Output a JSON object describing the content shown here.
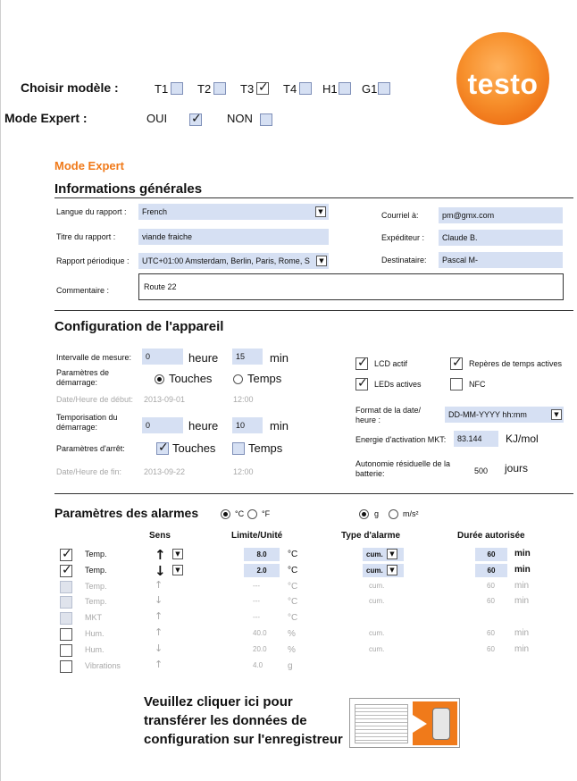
{
  "header": {
    "model_label": "Choisir modèle :",
    "models": [
      {
        "name": "T1",
        "checked": false
      },
      {
        "name": "T2",
        "checked": false
      },
      {
        "name": "T3",
        "checked": true
      },
      {
        "name": "T4",
        "checked": false
      },
      {
        "name": "H1",
        "checked": false
      },
      {
        "name": "G1",
        "checked": false
      }
    ],
    "expert_label": "Mode Expert :",
    "oui": "OUI",
    "non": "NON",
    "oui_checked": true,
    "non_checked": false,
    "logo": "testo",
    "brand_color": "#f07a1a"
  },
  "section_title": "Mode Expert",
  "general": {
    "title": "Informations générales",
    "langue_label": "Langue du rapport :",
    "langue_value": "French",
    "titre_label": "Titre du rapport :",
    "titre_value": "viande fraiche",
    "periodique_label": "Rapport périodique :",
    "periodique_value": "UTC+01:00  Amsterdam, Berlin, Paris, Rome, S",
    "courriel_label": "Courriel à:",
    "courriel_value": "pm@gmx.com",
    "expediteur_label": "Expéditeur :",
    "expediteur_value": "Claude B.",
    "destinataire_label": "Destinataire:",
    "destinataire_value": "Pascal M-",
    "commentaire_label": "Commentaire :",
    "commentaire_value": "Route 22"
  },
  "device": {
    "title": "Configuration de l'appareil",
    "intervalle_label": "Intervalle de mesure:",
    "intervalle_h": "0",
    "intervalle_m": "15",
    "heure": "heure",
    "min": "min",
    "demarrage_label": "Paramètres de démarrage:",
    "touches": "Touches",
    "temps": "Temps",
    "debut_label": "Date/Heure de début:",
    "debut_date": "2013-09-01",
    "debut_time": "12:00",
    "tempo_label": "Temporisation du démarrage:",
    "tempo_h": "0",
    "tempo_m": "10",
    "arret_label": "Paramètres d'arrêt:",
    "fin_label": "Date/Heure de fin:",
    "fin_date": "2013-09-22",
    "fin_time": "12:00",
    "lcd": "LCD actif",
    "reperes": "Repères de temps actives",
    "leds": "LEDs actives",
    "nfc": "NFC",
    "format_label": "Format de la date/ heure :",
    "format_value": "DD-MM-YYYY hh:mm",
    "mkt_label": "Energie d'activation MKT:",
    "mkt_value": "83.144",
    "mkt_unit": "KJ/mol",
    "autonomie_label": "Autonomie résiduelle de la batterie:",
    "autonomie_value": "500",
    "autonomie_unit": "jours"
  },
  "alarms": {
    "title": "Paramètres des alarmes",
    "unit_c": "°C",
    "unit_f": "°F",
    "unit_g": "g",
    "unit_ms": "m/s²",
    "col_sens": "Sens",
    "col_limite": "Limite/Unité",
    "col_type": "Type d'alarme",
    "col_duree": "Durée autorisée",
    "rows": [
      {
        "name": "Temp.",
        "sens": "↑",
        "limit": "8.0",
        "unit": "°C",
        "type": "cum.",
        "dur": "60",
        "min": "min",
        "state": "active",
        "checked": true
      },
      {
        "name": "Temp.",
        "sens": "↓",
        "limit": "2.0",
        "unit": "°C",
        "type": "cum.",
        "dur": "60",
        "min": "min",
        "state": "active",
        "checked": true
      },
      {
        "name": "Temp.",
        "sens": "↑",
        "limit": "---",
        "unit": "°C",
        "type": "cum.",
        "dur": "60",
        "min": "min",
        "state": "grey",
        "checked": false
      },
      {
        "name": "Temp.",
        "sens": "↓",
        "limit": "---",
        "unit": "°C",
        "type": "cum.",
        "dur": "60",
        "min": "min",
        "state": "grey",
        "checked": false
      },
      {
        "name": "MKT",
        "sens": "↑",
        "limit": "---",
        "unit": "°C",
        "type": "",
        "dur": "",
        "min": "",
        "state": "grey",
        "checked": false
      },
      {
        "name": "Hum.",
        "sens": "↑",
        "limit": "40.0",
        "unit": "%",
        "type": "cum.",
        "dur": "60",
        "min": "min",
        "state": "off",
        "checked": false
      },
      {
        "name": "Hum.",
        "sens": "↓",
        "limit": "20.0",
        "unit": "%",
        "type": "cum.",
        "dur": "60",
        "min": "min",
        "state": "off",
        "checked": false
      },
      {
        "name": "Vibrations",
        "sens": "↑",
        "limit": "4.0",
        "unit": "g",
        "type": "",
        "dur": "",
        "min": "",
        "state": "off",
        "checked": false
      }
    ]
  },
  "transfer": {
    "line1": "Veuillez cliquer ici pour",
    "line2": "transférer les données de",
    "line3": "configuration sur l'enregistreur"
  }
}
